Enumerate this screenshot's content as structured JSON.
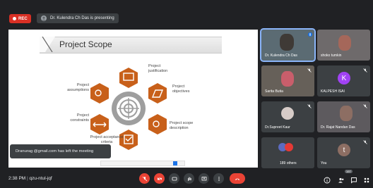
{
  "top": {
    "rec_label": "REC",
    "presenter_text": "Dr. Kulendra Ch Das is presenting"
  },
  "slide": {
    "title": "Project Scope",
    "labels": {
      "justification": "Project\njustification",
      "objectives": "Project\nobjectives",
      "assumptions": "Project\nassumptions",
      "constraints": "Project\nconstraints",
      "scope_description": "Project scope\ndescription",
      "acceptance": "Project acceptance\ncriteria"
    },
    "colors": {
      "hex": "#c8601a",
      "center": "#9e9e9e"
    }
  },
  "toast": {
    "text": "Dranurag @gmail.com has left the meeting"
  },
  "participants": [
    {
      "name": "Dr. Kulendra Ch Das",
      "type": "video",
      "speaking": true
    },
    {
      "name": "shoko tumkin",
      "type": "video"
    },
    {
      "name": "Sarita Butia",
      "type": "video"
    },
    {
      "name": "KALPESH ISAI",
      "type": "avatar",
      "initial": "K",
      "color": "#a142f4"
    },
    {
      "name": "Dr.Supreet Kaur",
      "type": "video"
    },
    {
      "name": "Dr. Rajat Nandan Das",
      "type": "video"
    },
    {
      "name": "189 others",
      "type": "others"
    },
    {
      "name": "You",
      "type": "avatar",
      "initial": "t",
      "color": "#8d6e63"
    }
  ],
  "bottom": {
    "time": "2:38 PM",
    "meeting_code": "qzu-ntul-jqf",
    "people_count": "197"
  }
}
